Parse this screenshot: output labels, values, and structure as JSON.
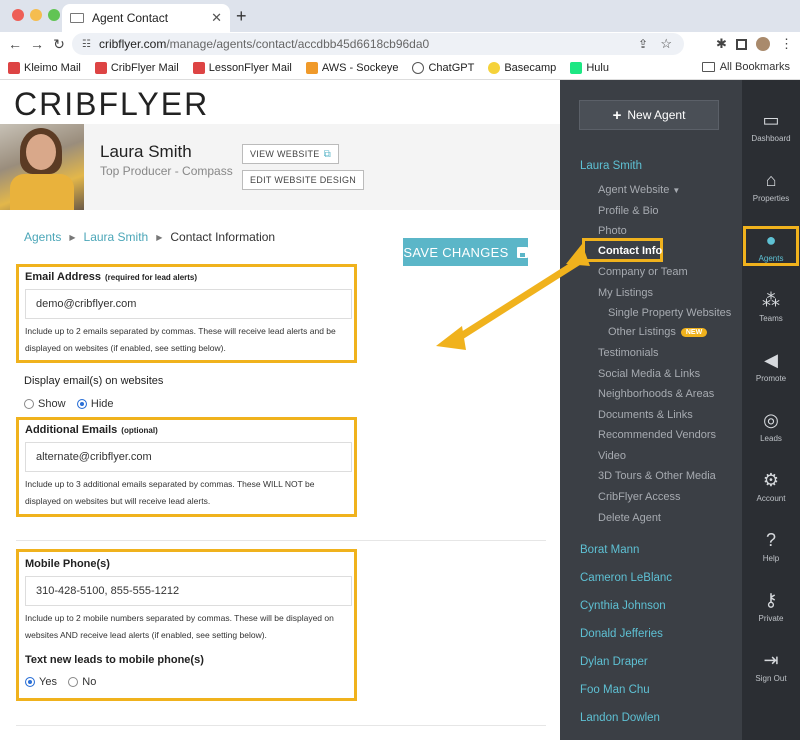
{
  "browser": {
    "tab_title": "Agent Contact",
    "url_host": "cribflyer.com",
    "url_path": "/manage/agents/contact/accdbb45d6618cb96da0",
    "bookmarks": [
      "Kleimo Mail",
      "CribFlyer Mail",
      "LessonFlyer Mail",
      "AWS - Sockeye",
      "ChatGPT",
      "Basecamp",
      "Hulu"
    ],
    "all_bookmarks": "All Bookmarks"
  },
  "brand": {
    "logo": "CRIBFLYER",
    "accent": "#5bb6c8",
    "highlight": "#f0b21d"
  },
  "agent": {
    "name": "Laura Smith",
    "subtitle": "Top Producer - Compass",
    "view_website": "VIEW WEBSITE",
    "edit_design": "EDIT WEBSITE DESIGN"
  },
  "breadcrumb": {
    "root": "Agents",
    "agent": "Laura Smith",
    "current": "Contact Information"
  },
  "save_button": "SAVE CHANGES",
  "form": {
    "email": {
      "label": "Email Address",
      "note": "(required for lead alerts)",
      "value": "demo@cribflyer.com",
      "help": "Include up to 2 emails separated by commas. These will receive lead alerts and be displayed on websites (if enabled, see setting below)."
    },
    "display_email": {
      "label": "Display email(s) on websites",
      "options": [
        "Show",
        "Hide"
      ],
      "selected": "Hide"
    },
    "additional": {
      "label": "Additional Emails",
      "note": "(optional)",
      "value": "alternate@cribflyer.com",
      "help": "Include up to 3 additional emails separated by commas. These WILL NOT be displayed on websites but will receive lead alerts."
    },
    "mobile": {
      "label": "Mobile Phone(s)",
      "value": "310-428-5100, 855-555-1212",
      "help": "Include up to 2 mobile numbers separated by commas. These will be displayed on websites AND receive lead alerts (if enabled, see setting below)."
    },
    "text_leads": {
      "label": "Text new leads to mobile phone(s)",
      "options": [
        "Yes",
        "No"
      ],
      "selected": "Yes"
    }
  },
  "sidebar": {
    "new_agent": "New Agent",
    "current_agent": "Laura Smith",
    "menu": [
      "Agent Website",
      "Profile & Bio",
      "Photo",
      "Contact Info",
      "Company or Team",
      "My Listings",
      "Single Property Websites",
      "Other Listings",
      "Testimonials",
      "Social Media & Links",
      "Neighborhoods & Areas",
      "Documents & Links",
      "Recommended Vendors",
      "Video",
      "3D Tours & Other Media",
      "CribFlyer Access",
      "Delete Agent"
    ],
    "new_badge": "NEW",
    "other_agents": [
      "Borat Mann",
      "Cameron LeBlanc",
      "Cynthia Johnson",
      "Donald Jefferies",
      "Dylan Draper",
      "Foo Man Chu",
      "Landon Dowlen"
    ]
  },
  "rail": [
    "Dashboard",
    "Properties",
    "Agents",
    "Teams",
    "Promote",
    "Leads",
    "Account",
    "Help",
    "Private",
    "Sign Out"
  ]
}
